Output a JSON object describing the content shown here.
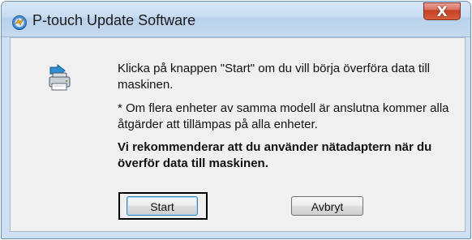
{
  "window": {
    "title": "P-touch Update Software",
    "close_symbol": "X",
    "app_icon": "ptouch-update-icon"
  },
  "dialog": {
    "icon": "transfer-to-printer-icon",
    "message_1": "Klicka på knappen \"Start\" om du vill börja överföra data till maskinen.",
    "message_2": "* Om flera enheter av samma modell är anslutna kommer alla åtgärder att tillämpas på alla enheter.",
    "message_3": "Vi rekommenderar att du använder nätadaptern när du överför data till maskinen."
  },
  "buttons": {
    "start_label": "Start",
    "cancel_label": "Avbryt"
  },
  "colors": {
    "window_frame": "#cfe0f2",
    "dialog_background": "#f0f0f0",
    "close_button": "#d75f3f",
    "focus_outline": "#000000"
  }
}
